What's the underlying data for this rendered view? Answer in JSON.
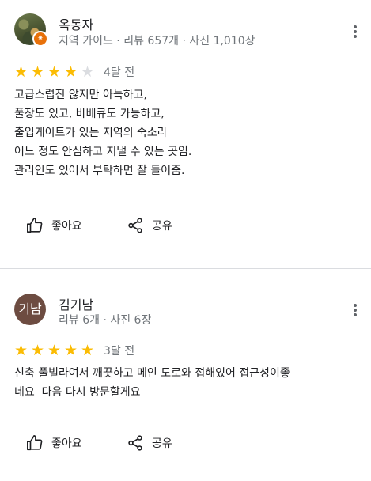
{
  "reviews": [
    {
      "name": "옥동자",
      "meta": "지역 가이드 · 리뷰 657개 · 사진 1,010장",
      "rating": 4,
      "time": "4달 전",
      "lines": [
        "고급스럽진 않지만 아늑하고,",
        "풀장도 있고, 바베큐도 가능하고,",
        "출입게이트가 있는 지역의 숙소라",
        "어느 정도 안심하고 지낼 수 있는 곳임.",
        "관리인도 있어서 부탁하면 잘 들어줌."
      ],
      "like_label": "좋아요",
      "share_label": "공유"
    },
    {
      "name": "김기남",
      "avatar_initials": "기남",
      "meta": "리뷰 6개 · 사진 6장",
      "rating": 5,
      "time": "3달 전",
      "lines": [
        "신축 풀빌라여서 깨끗하고 메인 도로와 접해있어 접근성이좋",
        "네요  다음 다시 방문할게요"
      ],
      "like_label": "좋아요",
      "share_label": "공유"
    }
  ],
  "colors": {
    "star": "#fbbc04",
    "star_empty": "#dadce0",
    "guide_badge": "#e8710a",
    "avatar_bg": "#6d4c41"
  },
  "icons": {
    "more": "more-vert-icon",
    "like": "thumb-up-icon",
    "share": "share-icon",
    "guide": "local-guide-badge-icon"
  }
}
